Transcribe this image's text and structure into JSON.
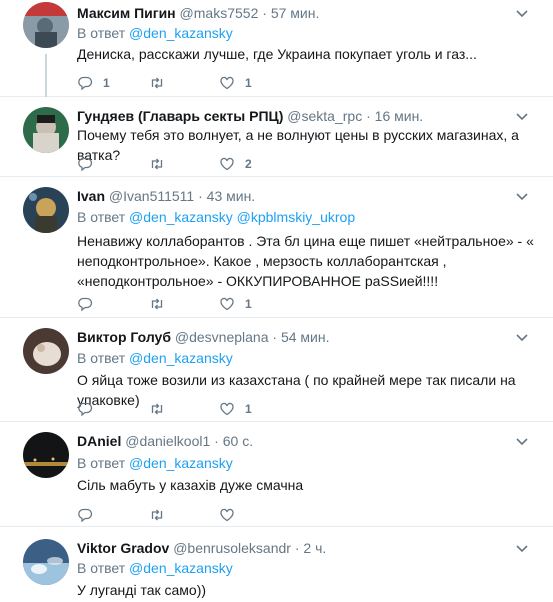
{
  "tweets": [
    {
      "name": "Максим Пигин",
      "handle": "@maks7552",
      "sep": " · ",
      "time": "57 мин.",
      "reply_prefix": "В ответ",
      "reply_to": [
        "@den_kazansky"
      ],
      "text": "Дениска, расскажи лучше, где Украина покупает уголь и газ...",
      "reply_count": "1",
      "retweet_count": "",
      "like_count": "1"
    },
    {
      "name": "Гундяев (Главарь секты РПЦ)",
      "handle": "@sekta_rpc",
      "sep": " · ",
      "time": "16 мин.",
      "reply_prefix": "",
      "reply_to": [],
      "text": "Почему тебя это волнует, а не волнуют цены в русских магазинах, а ватка?",
      "reply_count": "",
      "retweet_count": "",
      "like_count": "2"
    },
    {
      "name": "Ivan",
      "handle": "@Ivan511511",
      "sep": " · ",
      "time": "43 мин.",
      "reply_prefix": "В ответ",
      "reply_to": [
        "@den_kazansky",
        "@kpblmskiy_ukrop"
      ],
      "text": "Ненавижу коллаборантов . Эта бл  цина еще пишет «нейтральное» - « неподконтрольное». Какое , мерзость коллаборантская , «неподконтрольное» - ОККУПИРОВАННОЕ раSSией!!!!",
      "reply_count": "",
      "retweet_count": "",
      "like_count": "1"
    },
    {
      "name": "Виктор Голуб",
      "handle": "@desvneplana",
      "sep": " · ",
      "time": "54 мин.",
      "reply_prefix": "В ответ",
      "reply_to": [
        "@den_kazansky"
      ],
      "text": "О яйца тоже возили из казахстана ( по крайней мере так писали на упаковке)",
      "reply_count": "",
      "retweet_count": "",
      "like_count": "1"
    },
    {
      "name": "DAniel",
      "handle": "@danielkool1",
      "sep": " · ",
      "time": "60 с.",
      "reply_prefix": "В ответ",
      "reply_to": [
        "@den_kazansky"
      ],
      "text": "Сіль мабуть у казахів дуже смачна",
      "reply_count": "",
      "retweet_count": "",
      "like_count": ""
    },
    {
      "name": "Viktor Gradov",
      "handle": "@benrusoleksandr",
      "sep": " · ",
      "time": "2 ч.",
      "reply_prefix": "В ответ",
      "reply_to": [
        "@den_kazansky"
      ],
      "text": "У луганді так само))",
      "reply_count": "",
      "retweet_count": "",
      "like_count": ""
    }
  ],
  "avatars": [
    {
      "icon": "avatar-photo-icon",
      "colors": [
        "#5a6b78",
        "#c43a3a"
      ]
    },
    {
      "icon": "avatar-photo-icon",
      "colors": [
        "#2e6b4a",
        "#d8d4cc"
      ]
    },
    {
      "icon": "avatar-photo-icon",
      "colors": [
        "#2a4256",
        "#c9a35a"
      ]
    },
    {
      "icon": "avatar-photo-icon",
      "colors": [
        "#4a3a33",
        "#e7ddd2"
      ]
    },
    {
      "icon": "avatar-photo-icon",
      "colors": [
        "#121416",
        "#b38a3a"
      ]
    },
    {
      "icon": "avatar-photo-icon",
      "colors": [
        "#3c5f86",
        "#9ec3df"
      ]
    }
  ],
  "colors": {
    "link": "#1da1f2",
    "meta": "#657786",
    "text": "#14171a",
    "divider": "#e6ecf0",
    "thread_line": "#ccd6dd"
  }
}
